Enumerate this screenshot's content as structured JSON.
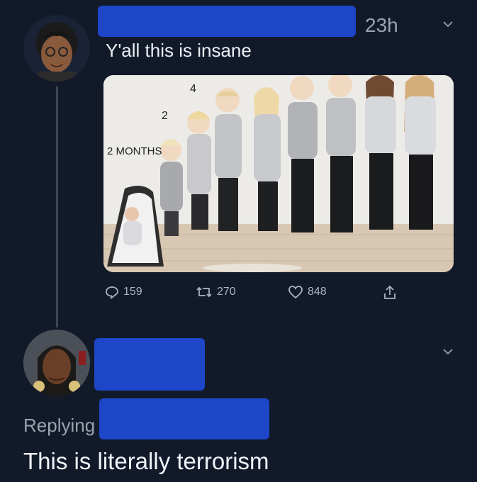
{
  "tweet1": {
    "time": "23h",
    "text": "Y'all this is insane",
    "media": {
      "labels": [
        "2 MONTHS",
        "2",
        "4"
      ]
    },
    "actions": {
      "replies": "159",
      "retweets": "270",
      "likes": "848"
    }
  },
  "tweet2": {
    "replying_prefix": "Replying",
    "text": "This is literally terrorism"
  },
  "icons": {
    "reply": "reply-icon",
    "retweet": "retweet-icon",
    "like": "heart-icon",
    "share": "share-icon",
    "caret": "chevron-down-icon"
  },
  "colors": {
    "background": "#121a2a",
    "text": "#e8ecf1",
    "muted": "#aab3bf",
    "redaction": "#1d46c8"
  }
}
